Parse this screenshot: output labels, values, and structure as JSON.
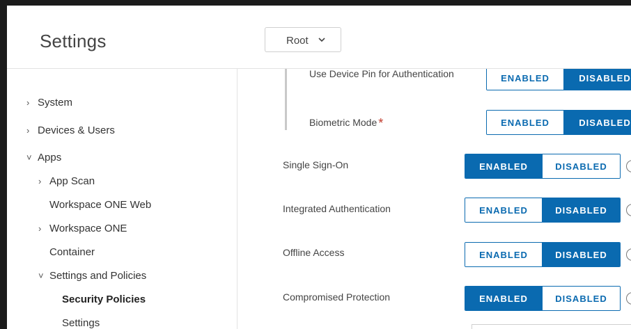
{
  "header": {
    "title": "Settings",
    "root_select": "Root"
  },
  "sidebar": {
    "items": [
      {
        "label": "System",
        "caret": "›"
      },
      {
        "label": "Devices & Users",
        "caret": "›"
      },
      {
        "label": "Apps",
        "caret": "˅"
      },
      {
        "label": "App Scan",
        "caret": "›"
      },
      {
        "label": "Workspace ONE Web",
        "caret": ""
      },
      {
        "label": "Workspace ONE",
        "caret": "›"
      },
      {
        "label": "Container",
        "caret": ""
      },
      {
        "label": "Settings and Policies",
        "caret": "˅"
      },
      {
        "label": "Security Policies",
        "caret": ""
      },
      {
        "label": "Settings",
        "caret": ""
      }
    ]
  },
  "toggle_labels": {
    "enabled": "ENABLED",
    "disabled": "DISABLED"
  },
  "settings": [
    {
      "label": "Use Device Pin for Authentication",
      "required": false,
      "value": "DISABLED"
    },
    {
      "label": "Biometric Mode",
      "required": true,
      "value": "DISABLED"
    },
    {
      "label": "Single Sign-On",
      "required": false,
      "value": "ENABLED"
    },
    {
      "label": "Integrated Authentication",
      "required": false,
      "value": "DISABLED"
    },
    {
      "label": "Offline Access",
      "required": false,
      "value": "DISABLED"
    },
    {
      "label": "Compromised Protection",
      "required": false,
      "value": "ENABLED"
    }
  ],
  "required_mark": "*",
  "colors": {
    "accent": "#0a6ab0",
    "required": "#c0392b"
  },
  "icons": {
    "select": "chevron-down-icon",
    "help": "help-circle-icon"
  }
}
